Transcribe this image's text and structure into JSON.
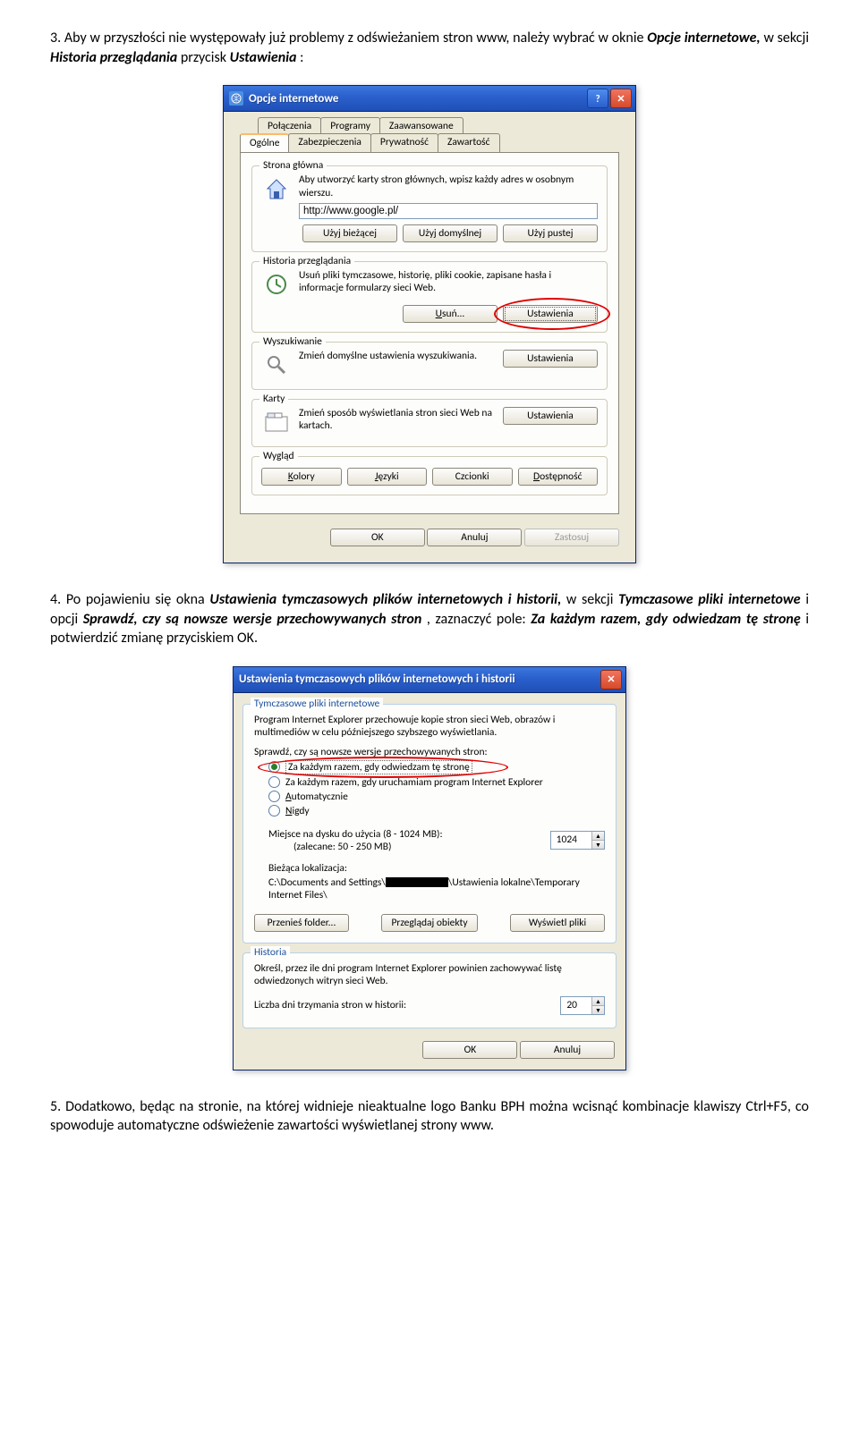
{
  "paragraphs": {
    "p3_prefix": "3. Aby w przyszłości nie występowały już problemy z odświeżaniem stron www, należy wybrać w oknie ",
    "p3_b1": "Opcje internetowe,",
    "p3_mid": " w sekcji ",
    "p3_b2": "Historia przeglądania",
    "p3_mid2": " przycisk ",
    "p3_b3": "Ustawienia",
    "p3_end": ":",
    "p4_prefix": "4. Po pojawieniu się  okna ",
    "p4_b1": "Ustawienia tymczasowych plików internetowych i historii,",
    "p4_mid": " w sekcji ",
    "p4_b2": "Tymczasowe pliki internetowe",
    "p4_mid2": " i opcji ",
    "p4_b3": "Sprawdź, czy są nowsze wersje przechowywanych stron",
    "p4_mid3": ", zaznaczyć pole:  ",
    "p4_b4": "Za każdym razem, gdy odwiedzam tę stronę",
    "p4_end": " i potwierdzić zmianę przyciskiem OK.",
    "p5": "5. Dodatkowo, będąc na stronie, na której widnieje nieaktualne logo Banku BPH można wcisnąć kombinacje klawiszy Ctrl+F5, co spowoduje automatyczne odświeżenie zawartości wyświetlanej strony www."
  },
  "win1": {
    "title": "Opcje internetowe",
    "help": "?",
    "close": "✕",
    "tabs_row1": [
      "Połączenia",
      "Programy",
      "Zaawansowane"
    ],
    "tabs_row2": [
      "Ogólne",
      "Zabezpieczenia",
      "Prywatność",
      "Zawartość"
    ],
    "home": {
      "legend": "Strona główna",
      "desc": "Aby utworzyć karty stron głównych, wpisz każdy adres w osobnym wierszu.",
      "url": "http://www.google.pl/",
      "btn1": "Użyj bieżącej",
      "btn2": "Użyj domyślnej",
      "btn3": "Użyj pustej"
    },
    "history": {
      "legend": "Historia przeglądania",
      "desc": "Usuń pliki tymczasowe, historię, pliki cookie, zapisane hasła i informacje formularzy sieci Web.",
      "btn_del": "Usuń...",
      "btn_set": "Ustawienia"
    },
    "search": {
      "legend": "Wyszukiwanie",
      "desc": "Zmień domyślne ustawienia wyszukiwania.",
      "btn": "Ustawienia"
    },
    "cards": {
      "legend": "Karty",
      "desc": "Zmień sposób wyświetlania stron sieci Web na kartach.",
      "btn": "Ustawienia"
    },
    "look": {
      "legend": "Wygląd",
      "btns": [
        "Kolory",
        "Języki",
        "Czcionki",
        "Dostępność"
      ]
    },
    "footer": {
      "ok": "OK",
      "cancel": "Anuluj",
      "apply": "Zastosuj"
    }
  },
  "win2": {
    "title": "Ustawienia tymczasowych plików internetowych i historii",
    "close": "✕",
    "g_temp": {
      "legend": "Tymczasowe pliki internetowe",
      "desc": "Program Internet Explorer przechowuje kopie stron sieci Web, obrazów i multimediów w celu późniejszego szybszego wyświetlania.",
      "check_label": "Sprawdź, czy są nowsze wersje przechowywanych stron:",
      "r1": "Za każdym razem, gdy odwiedzam tę stronę",
      "r2": "Za każdym razem, gdy uruchamiam program Internet Explorer",
      "r3": "Automatycznie",
      "r4": "Nigdy",
      "disk_label": "Miejsce na dysku do użycia (8 - 1024 MB):",
      "disk_rec": "(zalecane: 50 - 250 MB)",
      "disk_val": "1024",
      "loc_label": "Bieżąca lokalizacja:",
      "loc_path1": "C:\\Documents and Settings\\",
      "loc_path2": "\\Ustawienia lokalne\\Temporary Internet Files\\",
      "btn1": "Przenieś folder...",
      "btn2": "Przeglądaj obiekty",
      "btn3": "Wyświetl pliki"
    },
    "g_hist": {
      "legend": "Historia",
      "desc": "Określ, przez ile dni program Internet Explorer powinien zachowywać listę odwiedzonych witryn sieci Web.",
      "days_label": "Liczba dni trzymania stron w historii:",
      "days_val": "20"
    },
    "footer": {
      "ok": "OK",
      "cancel": "Anuluj"
    }
  }
}
